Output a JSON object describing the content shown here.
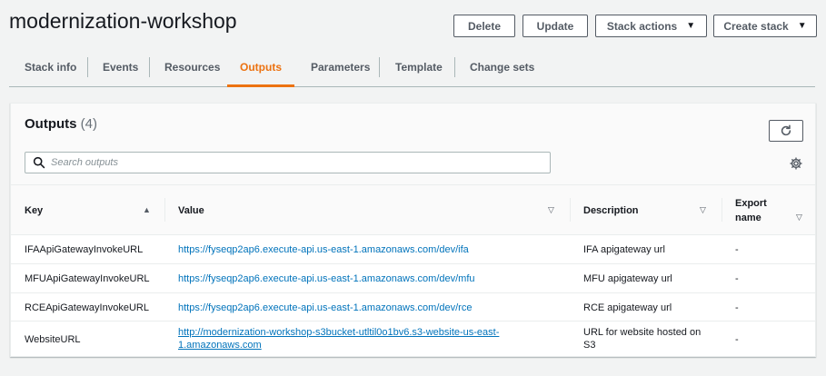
{
  "header": {
    "title": "modernization-workshop",
    "buttons": {
      "delete": "Delete",
      "update": "Update",
      "stack_actions": "Stack actions",
      "create_stack": "Create stack"
    }
  },
  "tabs": [
    {
      "label": "Stack info"
    },
    {
      "label": "Events"
    },
    {
      "label": "Resources"
    },
    {
      "label": "Outputs",
      "active": true
    },
    {
      "label": "Parameters"
    },
    {
      "label": "Template"
    },
    {
      "label": "Change sets"
    }
  ],
  "outputs": {
    "title": "Outputs",
    "count": "(4)",
    "search_placeholder": "Search outputs",
    "columns": {
      "key": "Key",
      "value": "Value",
      "description": "Description",
      "export_name_1": "Export",
      "export_name_2": "name"
    },
    "rows": [
      {
        "key": "IFAApiGatewayInvokeURL",
        "value": "https://fyseqp2ap6.execute-api.us-east-1.amazonaws.com/dev/ifa",
        "description": "IFA apigateway url",
        "export": "-"
      },
      {
        "key": "MFUApiGatewayInvokeURL",
        "value": "https://fyseqp2ap6.execute-api.us-east-1.amazonaws.com/dev/mfu",
        "description": "MFU apigateway url",
        "export": "-"
      },
      {
        "key": "RCEApiGatewayInvokeURL",
        "value": "https://fyseqp2ap6.execute-api.us-east-1.amazonaws.com/dev/rce",
        "description": "RCE apigateway url",
        "export": "-"
      },
      {
        "key": "WebsiteURL",
        "value_line1": "http://modernization-workshop-s3bucket-utltil0o1bv6.s3-website-us-east-",
        "value_line2": "1.amazonaws.com",
        "description_line1": "URL for website hosted on",
        "description_line2": "S3",
        "export": "-"
      }
    ]
  },
  "colors": {
    "accent": "#ec7211",
    "link": "#0073bb",
    "text": "#16191f",
    "background": "#f2f3f3"
  }
}
